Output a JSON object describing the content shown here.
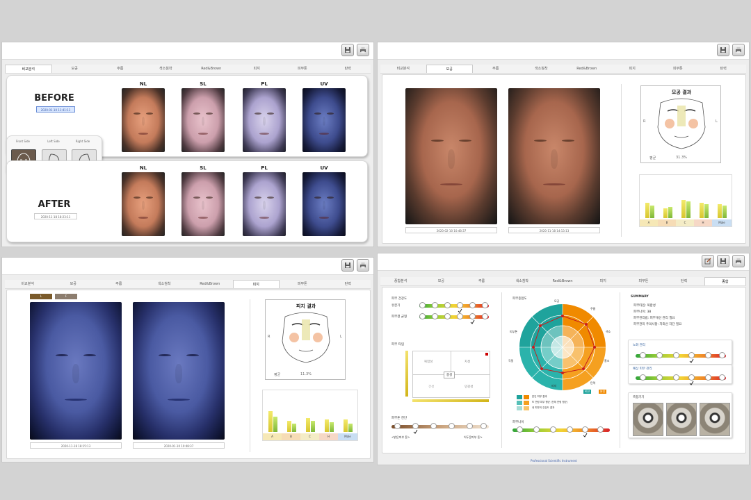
{
  "colors": {
    "background": "#d3d3d3",
    "orange": "#f08a00",
    "teal": "#1fa39c",
    "bar_yellow": "#e6d83a"
  },
  "toolbar_icons": [
    "save-icon",
    "print-icon",
    "edit-icon"
  ],
  "panel1": {
    "tabs": [
      "비교분석",
      "모공",
      "주름",
      "색소침착",
      "Red&Brown",
      "피지",
      "피부톤",
      "탄력"
    ],
    "active_tab": 0,
    "before_label": "BEFORE",
    "after_label": "AFTER",
    "before_date": "2020-01-10 11:41:11",
    "after_date": "2020-11-18 18:23:11",
    "modes": [
      "NL",
      "SL",
      "PL",
      "UV"
    ],
    "views": [
      "Front Side",
      "Left Side",
      "Right Side"
    ]
  },
  "panel2": {
    "tabs": [
      "비교분석",
      "모공",
      "주름",
      "색소침착",
      "Red&Brown",
      "피지",
      "피부톤",
      "탄력"
    ],
    "active_tab": 1,
    "date_left": "2020-02-10 10:48:37",
    "date_right": "2020-11-18 14:13:13",
    "result_title": "모공 결과",
    "result_left": "R",
    "result_right": "L",
    "total_label": "평균",
    "total_value": "31.3%",
    "bar_categories": [
      "A",
      "B",
      "C",
      "H",
      "Male"
    ]
  },
  "panel3": {
    "tabs": [
      "비교분석",
      "모공",
      "주름",
      "색소침착",
      "Red&Brown",
      "피지",
      "피부톤",
      "탄력"
    ],
    "active_tab": 5,
    "toggle_a": "L",
    "toggle_b": "F",
    "date_left": "2020-11-18 18:15:13",
    "date_right": "2020-01-10 10:48:37",
    "result_title": "피지 결과",
    "result_left": "R",
    "result_right": "L",
    "total_label": "평균",
    "total_value": "11.3%",
    "bar_categories": [
      "A",
      "B",
      "C",
      "H",
      "Male"
    ]
  },
  "panel4": {
    "tabs": [
      "종합분석",
      "모공",
      "주름",
      "색소침착",
      "Red&Brown",
      "피지",
      "피부톤",
      "탄력",
      "종합"
    ],
    "active_tab": 8,
    "sec_pore": "피부 건강도",
    "row1_label": "유분기",
    "row2_label": "피부결 균형",
    "sec_type": "피부 타입",
    "type_cells": [
      "복합성",
      "지성",
      "중성",
      "건성",
      "민감성"
    ],
    "sec_tone": "피부톤 진단",
    "tone_left": "<밝은피부 톤>",
    "tone_right": "어두운피부 톤>",
    "sec_radar": "피부종합도",
    "radar_labels": [
      "모공",
      "주름",
      "색소",
      "홍조",
      "탄력",
      "피지",
      "각질",
      "피부톤"
    ],
    "legend": [
      "본인 피부 결과",
      "또 연령 피부 평균 (전체 연령 평균)",
      "내 피부의 건강도 결과"
    ],
    "legend_chips": [
      "비교",
      "본인"
    ],
    "sec_age": "피부나이",
    "summary_title": "SUMMARY",
    "summary_lines": [
      "피부타입: 복합성",
      "피부나이: 38",
      "피부관리법: 피부개선 관리 필요",
      "피부관리 주의사항: 자외선 차단 필요"
    ],
    "sec_elastic": "노화 관리",
    "sec_future": "예상 피부 관리",
    "sec_device": "측정기기",
    "footer": "Professional Scientific Instrument"
  }
}
